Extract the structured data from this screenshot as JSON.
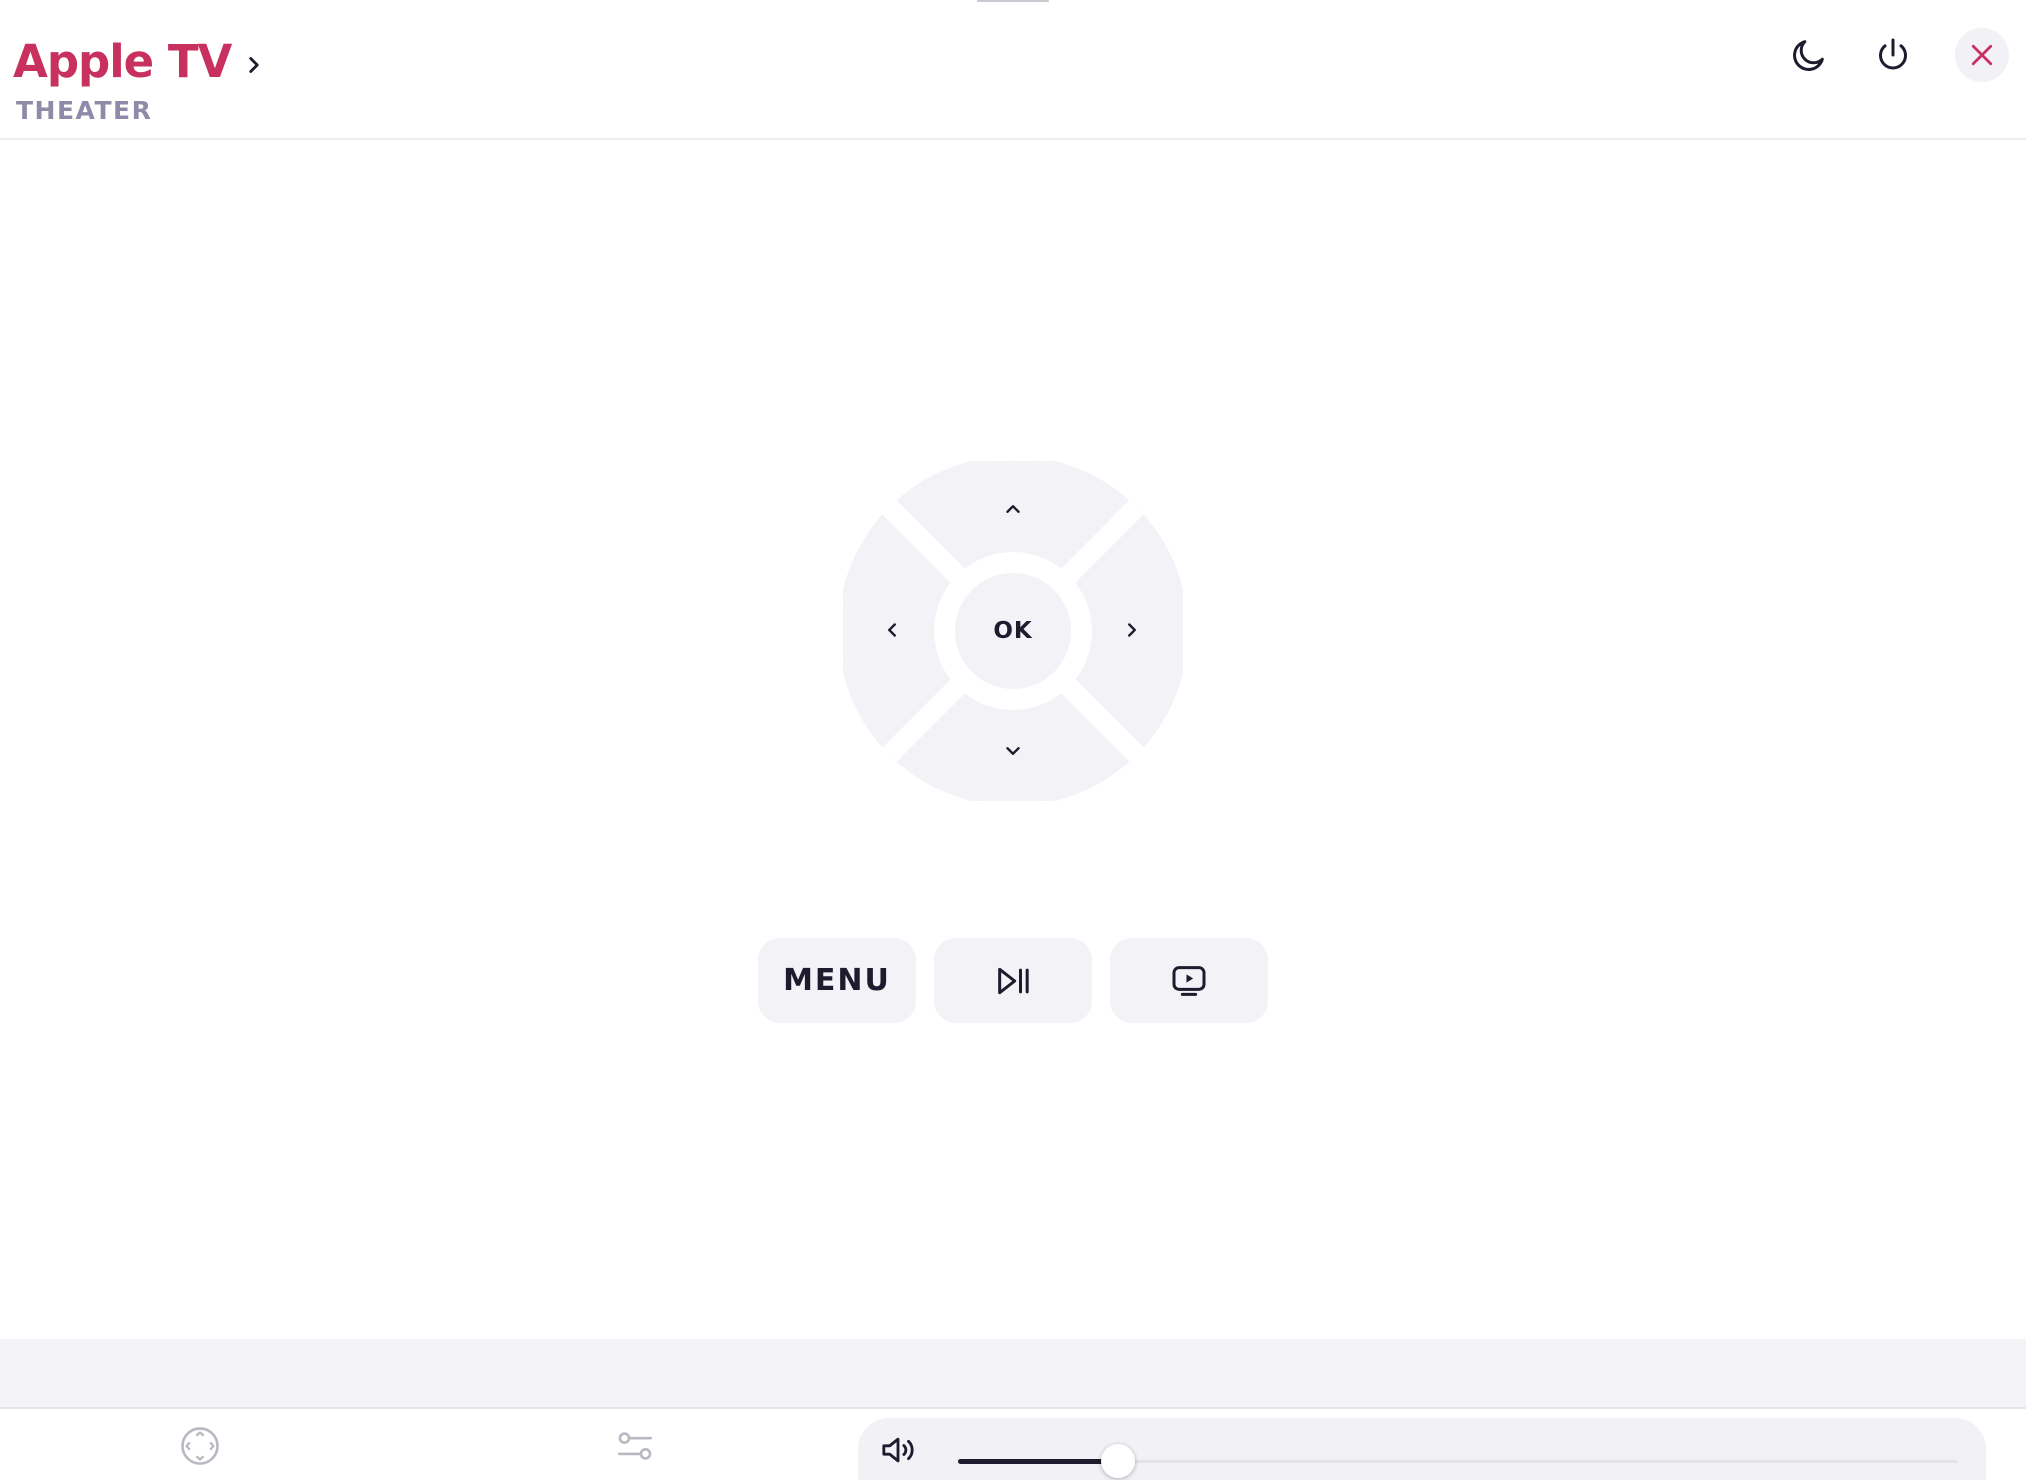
{
  "header": {
    "title": "Apple TV",
    "subtitle": "THEATER",
    "title_color": "#c8315f",
    "subtitle_color": "#8d8ba7",
    "icons": [
      "chevron-right-icon",
      "moon-icon",
      "power-icon",
      "close-icon"
    ]
  },
  "remote": {
    "ok_label": "OK",
    "pad_color": "#f2f2f7",
    "icons": [
      "chevron-up-icon",
      "chevron-down-icon",
      "chevron-left-icon",
      "chevron-right-icon"
    ]
  },
  "controls": {
    "menu_label": "MENU",
    "icons": [
      "play-pause-icon",
      "tv-icon"
    ]
  },
  "bottom_nav": {
    "icons": [
      "dpad-icon",
      "sliders-icon",
      "volume-icon"
    ]
  },
  "volume": {
    "level": 0.16,
    "fill_color": "#1c1c2e"
  },
  "colors": {
    "accent": "#c8315f",
    "close_icon": "#c8315f",
    "text": "#1c1c2e"
  }
}
